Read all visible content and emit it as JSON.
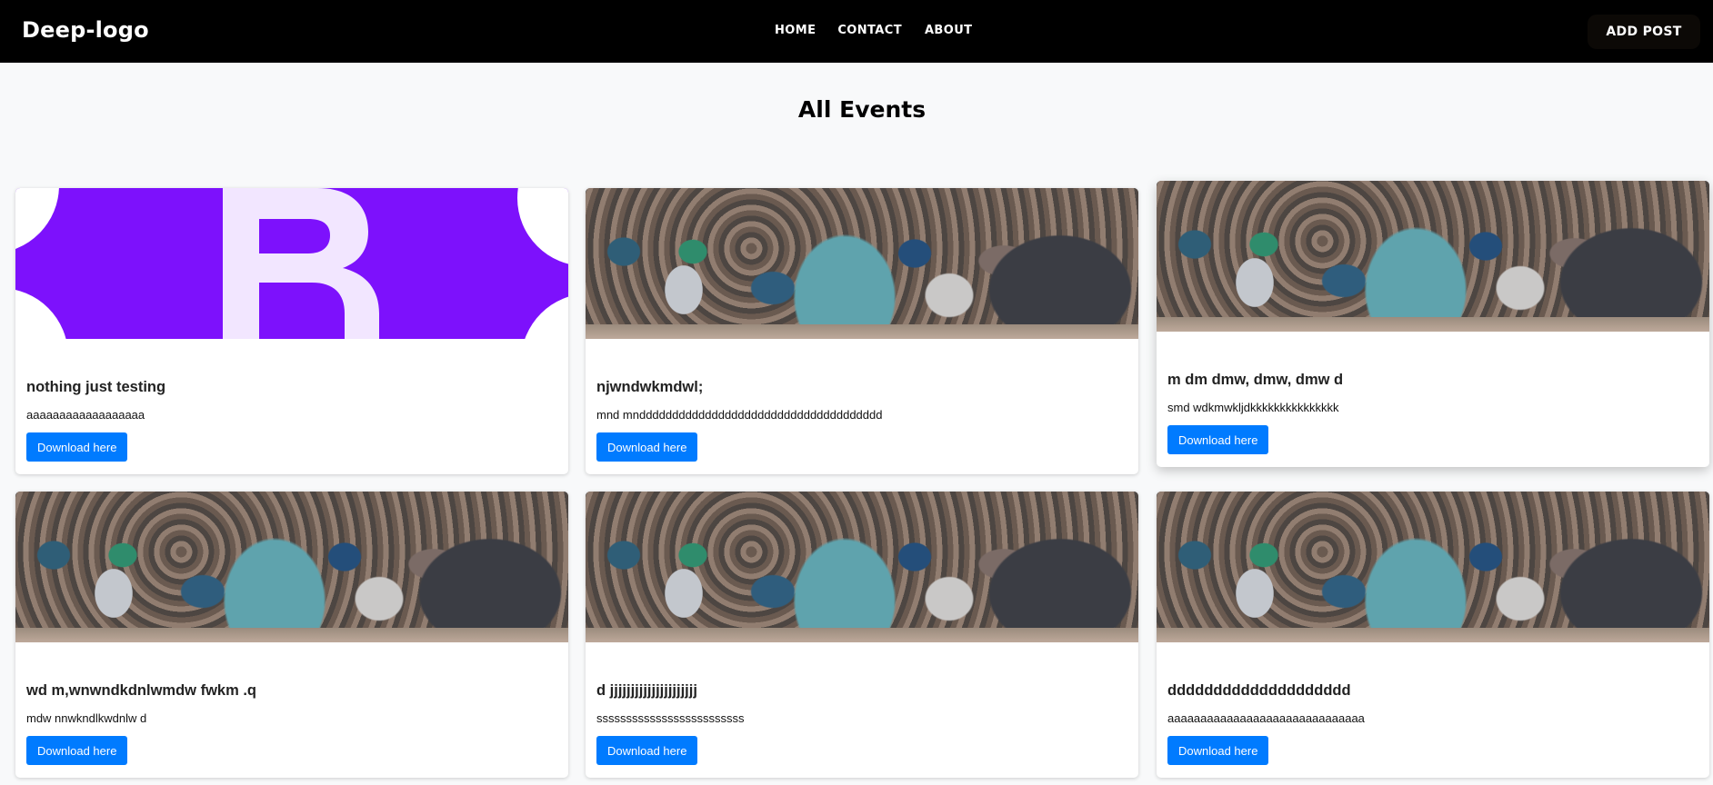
{
  "header": {
    "brand": "Deep-logo",
    "nav": [
      "HOME",
      "CONTACT",
      "ABOUT"
    ],
    "add_post": "ADD POST"
  },
  "page": {
    "title": "All Events"
  },
  "events": [
    {
      "title": "nothing just testing",
      "text": "aaaaaaaaaaaaaaaaaa",
      "button": "Download here"
    },
    {
      "title": "njwndwkmdwl;",
      "text": "mnd mnddddddddddddddddddddddddddddddddddddd",
      "button": "Download here"
    },
    {
      "title": "m dm dmw, dmw, dmw d",
      "text": "smd wdkmwkljdkkkkkkkkkkkkkkk",
      "button": "Download here"
    },
    {
      "title": "wd m,wnwndkdnlwmdw fwkm .q",
      "text": "mdw nnwkndlkwdnlw d",
      "button": "Download here"
    },
    {
      "title": "d jjjjjjjjjjjjjjjjjjjjj",
      "text": "sssssssssssssssssssssssss",
      "button": "Download here"
    },
    {
      "title": "dddddddddddddddddddd",
      "text": "aaaaaaaaaaaaaaaaaaaaaaaaaaaaaa",
      "button": "Download here"
    }
  ],
  "colors": {
    "primary_button": "#007bff",
    "navbar": "#000000",
    "bootstrap_purple": "#7d11fc"
  }
}
